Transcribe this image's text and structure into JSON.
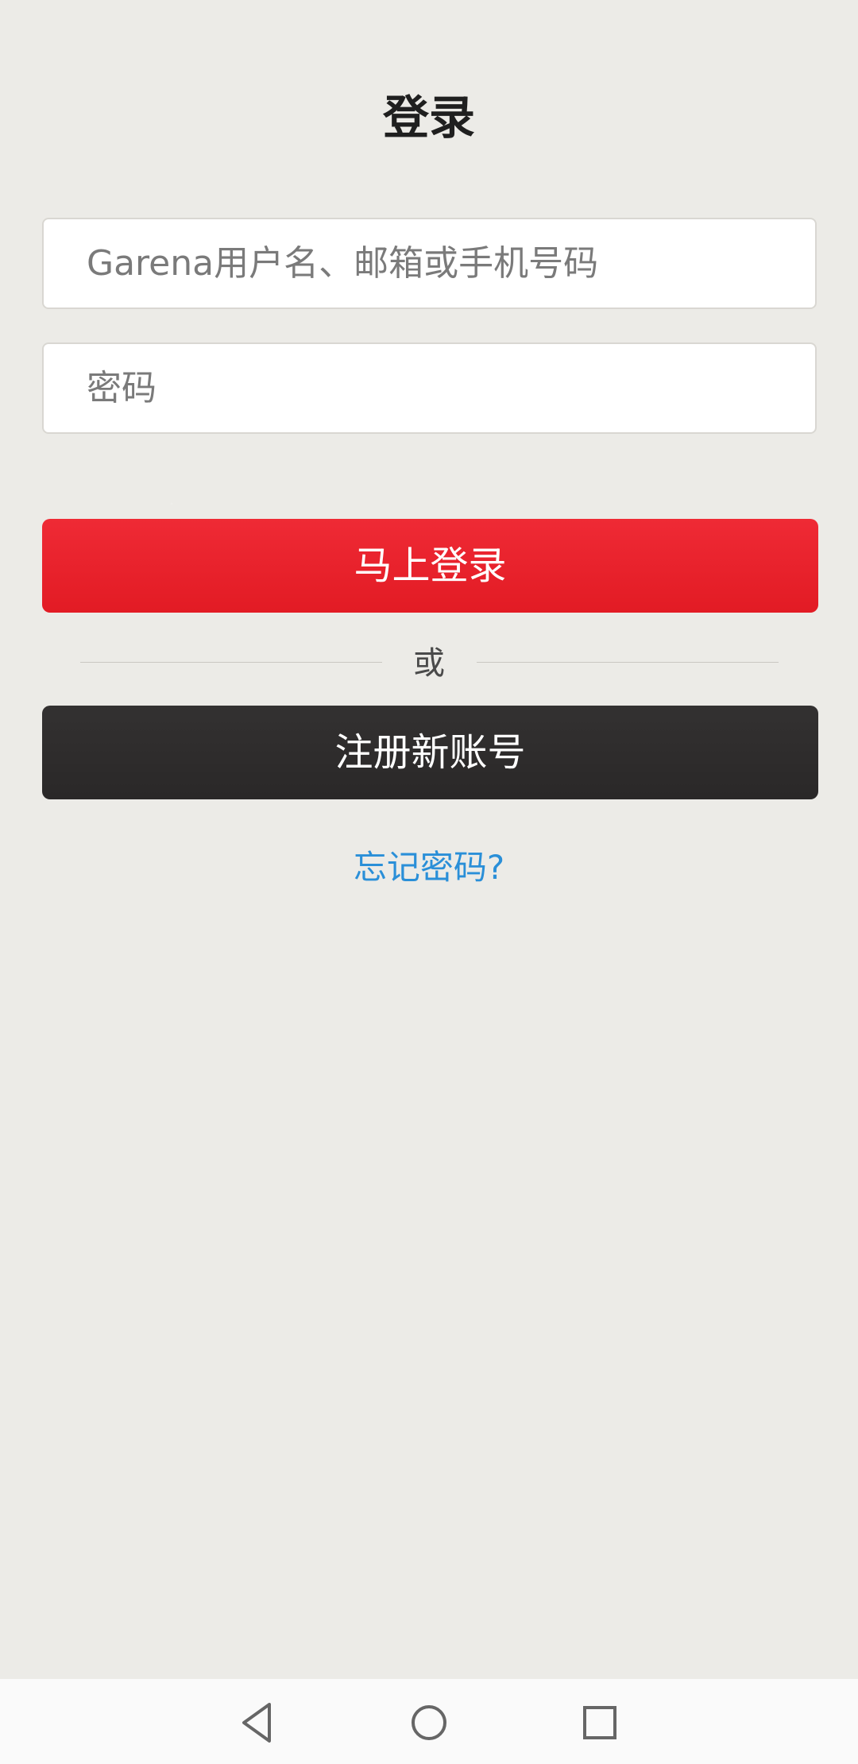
{
  "header": {
    "title": "登录"
  },
  "form": {
    "username_placeholder": "Garena用户名、邮箱或手机号码",
    "password_placeholder": "密码",
    "login_label": "马上登录",
    "divider_text": "或",
    "register_label": "注册新账号",
    "forgot_label": "忘记密码?"
  },
  "colors": {
    "background": "#ecebe7",
    "login_button": "#e8222d",
    "register_button": "#2f2d2d",
    "link": "#2a8fd8"
  },
  "navbar": {
    "icons": [
      "back-icon",
      "home-icon",
      "recents-icon"
    ]
  }
}
